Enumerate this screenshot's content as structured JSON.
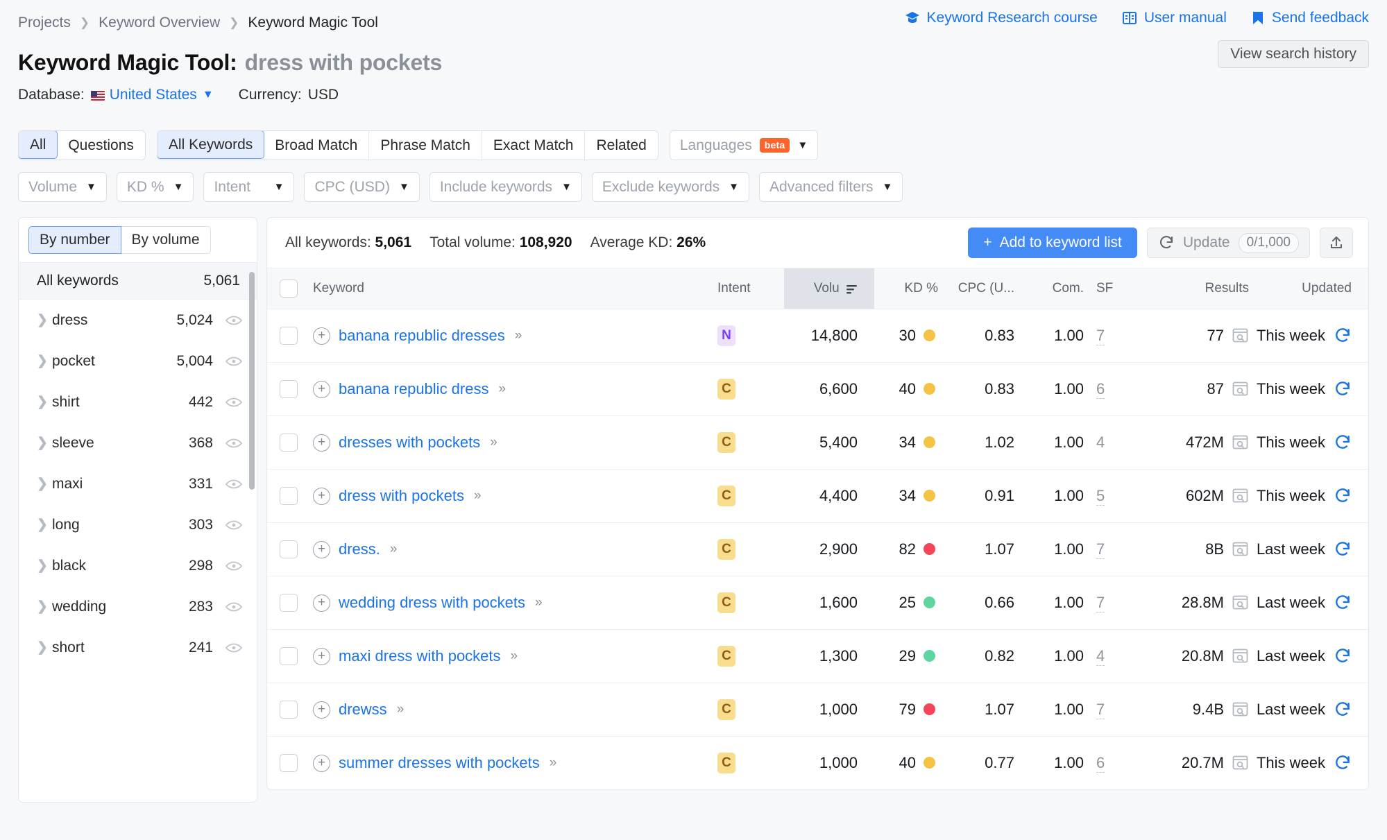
{
  "breadcrumb": {
    "items": [
      "Projects",
      "Keyword Overview",
      "Keyword Magic Tool"
    ],
    "separator": "❯"
  },
  "header": {
    "title_prefix": "Keyword Magic Tool:",
    "query": "dress with pockets",
    "database_label": "Database:",
    "database_value": "United States",
    "currency_label": "Currency:",
    "currency_value": "USD",
    "view_search_history": "View search history",
    "links": [
      {
        "label": "Keyword Research course",
        "icon": "graduation-cap-icon"
      },
      {
        "label": "User manual",
        "icon": "book-icon"
      },
      {
        "label": "Send feedback",
        "icon": "flag-icon"
      }
    ]
  },
  "filters": {
    "group_a": [
      {
        "label": "All",
        "active": true
      },
      {
        "label": "Questions",
        "active": false
      }
    ],
    "group_b": [
      {
        "label": "All Keywords",
        "active": true
      },
      {
        "label": "Broad Match",
        "active": false
      },
      {
        "label": "Phrase Match",
        "active": false
      },
      {
        "label": "Exact Match",
        "active": false
      },
      {
        "label": "Related",
        "active": false
      }
    ],
    "languages": {
      "label": "Languages",
      "badge": "beta"
    },
    "dropdowns": [
      {
        "label": "Volume"
      },
      {
        "label": "KD %"
      },
      {
        "label": "Intent"
      },
      {
        "label": "CPC (USD)"
      },
      {
        "label": "Include keywords"
      },
      {
        "label": "Exclude keywords"
      },
      {
        "label": "Advanced filters"
      }
    ]
  },
  "sidebar": {
    "toggle": [
      {
        "label": "By number",
        "active": true
      },
      {
        "label": "By volume",
        "active": false
      }
    ],
    "all_keywords_label": "All keywords",
    "all_keywords_count": "5,061",
    "items": [
      {
        "label": "dress",
        "count": "5,024"
      },
      {
        "label": "pocket",
        "count": "5,004"
      },
      {
        "label": "shirt",
        "count": "442"
      },
      {
        "label": "sleeve",
        "count": "368"
      },
      {
        "label": "maxi",
        "count": "331"
      },
      {
        "label": "long",
        "count": "303"
      },
      {
        "label": "black",
        "count": "298"
      },
      {
        "label": "wedding",
        "count": "283"
      },
      {
        "label": "short",
        "count": "241"
      }
    ]
  },
  "panel": {
    "stats": [
      {
        "label": "All keywords:",
        "value": "5,061"
      },
      {
        "label": "Total volume:",
        "value": "108,920"
      },
      {
        "label": "Average KD:",
        "value": "26%"
      }
    ],
    "add_to_list": "Add to keyword list",
    "add_icon": "plus-icon",
    "update_label": "Update",
    "update_counter": "0/1,000",
    "export_icon": "export-icon"
  },
  "table": {
    "columns": [
      {
        "key": "checkbox",
        "label": ""
      },
      {
        "key": "keyword",
        "label": "Keyword"
      },
      {
        "key": "intent",
        "label": "Intent"
      },
      {
        "key": "volume",
        "label": "Volu",
        "sorted": true
      },
      {
        "key": "kd",
        "label": "KD %"
      },
      {
        "key": "cpc",
        "label": "CPC (U..."
      },
      {
        "key": "com",
        "label": "Com."
      },
      {
        "key": "sf",
        "label": "SF"
      },
      {
        "key": "results",
        "label": "Results"
      },
      {
        "key": "updated",
        "label": "Updated"
      }
    ],
    "rows": [
      {
        "keyword": "banana republic dresses",
        "intent": "N",
        "volume": "14,800",
        "kd": "30",
        "kd_color": "#f5c344",
        "cpc": "0.83",
        "com": "1.00",
        "sf": "7",
        "sf_dashed": true,
        "results": "77",
        "updated": "This week"
      },
      {
        "keyword": "banana republic dress",
        "intent": "C",
        "volume": "6,600",
        "kd": "40",
        "kd_color": "#f5c344",
        "cpc": "0.83",
        "com": "1.00",
        "sf": "6",
        "sf_dashed": true,
        "results": "87",
        "updated": "This week"
      },
      {
        "keyword": "dresses with pockets",
        "intent": "C",
        "volume": "5,400",
        "kd": "34",
        "kd_color": "#f5c344",
        "cpc": "1.02",
        "com": "1.00",
        "sf": "4",
        "sf_dashed": false,
        "results": "472M",
        "updated": "This week"
      },
      {
        "keyword": "dress with pockets",
        "intent": "C",
        "volume": "4,400",
        "kd": "34",
        "kd_color": "#f5c344",
        "cpc": "0.91",
        "com": "1.00",
        "sf": "5",
        "sf_dashed": true,
        "results": "602M",
        "updated": "This week"
      },
      {
        "keyword": "dress.",
        "intent": "C",
        "volume": "2,900",
        "kd": "82",
        "kd_color": "#f4455a",
        "cpc": "1.07",
        "com": "1.00",
        "sf": "7",
        "sf_dashed": true,
        "results": "8B",
        "updated": "Last week"
      },
      {
        "keyword": "wedding dress with pockets",
        "intent": "C",
        "volume": "1,600",
        "kd": "25",
        "kd_color": "#5fd6a0",
        "cpc": "0.66",
        "com": "1.00",
        "sf": "7",
        "sf_dashed": true,
        "results": "28.8M",
        "updated": "Last week"
      },
      {
        "keyword": "maxi dress with pockets",
        "intent": "C",
        "volume": "1,300",
        "kd": "29",
        "kd_color": "#5fd6a0",
        "cpc": "0.82",
        "com": "1.00",
        "sf": "4",
        "sf_dashed": true,
        "results": "20.8M",
        "updated": "Last week"
      },
      {
        "keyword": "drewss",
        "intent": "C",
        "volume": "1,000",
        "kd": "79",
        "kd_color": "#f4455a",
        "cpc": "1.07",
        "com": "1.00",
        "sf": "7",
        "sf_dashed": true,
        "results": "9.4B",
        "updated": "Last week"
      },
      {
        "keyword": "summer dresses with pockets",
        "intent": "C",
        "volume": "1,000",
        "kd": "40",
        "kd_color": "#f5c344",
        "cpc": "0.77",
        "com": "1.00",
        "sf": "6",
        "sf_dashed": true,
        "results": "20.7M",
        "updated": "This week"
      }
    ],
    "expand_icon": "double-chevron-right-icon",
    "add_keyword_icon": "plus-circle-icon",
    "serp_icon": "serp-preview-icon",
    "refresh_icon": "refresh-icon"
  },
  "colors": {
    "accent": "#1a73e8",
    "primary_button": "#458bf5",
    "beta_badge": "#ff642d",
    "kd_easy": "#5fd6a0",
    "kd_medium": "#f5c344",
    "kd_hard": "#f4455a"
  }
}
